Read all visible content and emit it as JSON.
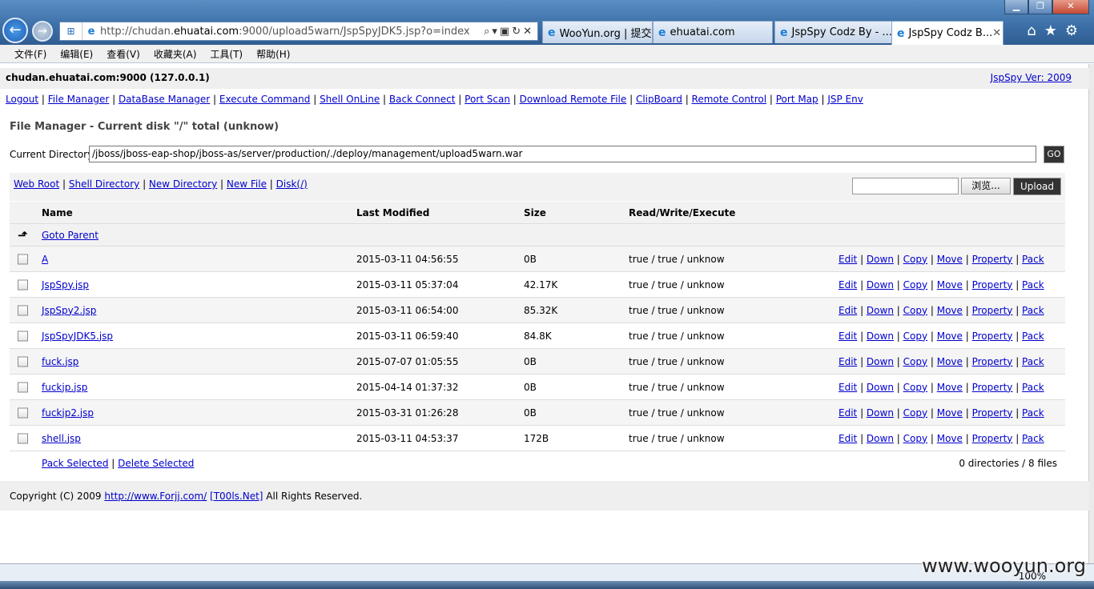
{
  "browser": {
    "address_url_prefix": "http://chudan.",
    "address_url_host": "ehuatai.com",
    "address_url_rest": ":9000/upload5warn/JspSpyJDK5.jsp?o=index",
    "tabs": [
      {
        "label": "WooYun.org | 提交..."
      },
      {
        "label": "ehuatai.com"
      },
      {
        "label": "JspSpy Codz By - ..."
      },
      {
        "label": "JspSpy Codz B...",
        "active": true
      }
    ],
    "menu": [
      "文件(F)",
      "编辑(E)",
      "查看(V)",
      "收藏夹(A)",
      "工具(T)",
      "帮助(H)"
    ],
    "zoom": "100%"
  },
  "header": {
    "host": "chudan.ehuatai.com:9000 (127.0.0.1)",
    "version_link": "JspSpy Ver: 2009"
  },
  "nav": [
    "Logout",
    "File Manager",
    "DataBase Manager",
    "Execute Command",
    "Shell OnLine",
    "Back Connect",
    "Port Scan",
    "Download Remote File",
    "ClipBoard",
    "Remote Control",
    "Port Map",
    "JSP Env"
  ],
  "file_manager": {
    "title": "File Manager - Current disk \"/\" total (unknow)",
    "current_dir_label": "Current Directory",
    "current_dir_value": "/jboss/jboss-eap-shop/jboss-as/server/production/./deploy/management/upload5warn.war",
    "go_label": "GO",
    "tool_links": [
      "Web Root",
      "Shell Directory",
      "New Directory",
      "New File",
      "Disk(/)"
    ],
    "browse_label": "浏览...",
    "upload_label": "Upload",
    "columns": [
      "Name",
      "Last Modified",
      "Size",
      "Read/Write/Execute"
    ],
    "goto_parent": "Goto Parent",
    "files": [
      {
        "name": "A",
        "modified": "2015-03-11 04:56:55",
        "size": "0B",
        "rwx": "true / true / unknow"
      },
      {
        "name": "JspSpy.jsp",
        "modified": "2015-03-11 05:37:04",
        "size": "42.17K",
        "rwx": "true / true / unknow"
      },
      {
        "name": "JspSpy2.jsp",
        "modified": "2015-03-11 06:54:00",
        "size": "85.32K",
        "rwx": "true / true / unknow"
      },
      {
        "name": "JspSpyJDK5.jsp",
        "modified": "2015-03-11 06:59:40",
        "size": "84.8K",
        "rwx": "true / true / unknow"
      },
      {
        "name": "fuck.jsp",
        "modified": "2015-07-07 01:05:55",
        "size": "0B",
        "rwx": "true / true / unknow"
      },
      {
        "name": "fuckjp.jsp",
        "modified": "2015-04-14 01:37:32",
        "size": "0B",
        "rwx": "true / true / unknow"
      },
      {
        "name": "fuckjp2.jsp",
        "modified": "2015-03-31 01:26:28",
        "size": "0B",
        "rwx": "true / true / unknow"
      },
      {
        "name": "shell.jsp",
        "modified": "2015-03-11 04:53:37",
        "size": "172B",
        "rwx": "true / true / unknow"
      }
    ],
    "actions": [
      "Edit",
      "Down",
      "Copy",
      "Move",
      "Property",
      "Pack"
    ],
    "pack_selected": "Pack Selected",
    "delete_selected": "Delete Selected",
    "count": "0 directories / 8 files"
  },
  "footer": {
    "copyright_prefix": "Copyright (C) 2009",
    "link1": "http://www.Forjj.com/",
    "link2": "[T00ls.Net]",
    "suffix": "All Rights Reserved."
  },
  "watermark": "www.wooyun.org"
}
